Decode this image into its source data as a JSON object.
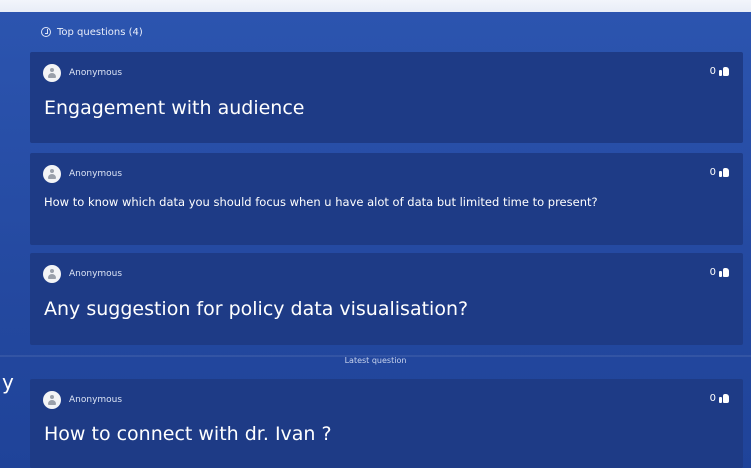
{
  "section": {
    "icon": "question-circle-icon",
    "title": "Top questions (4)"
  },
  "questions": [
    {
      "author": "Anonymous",
      "votes": "0",
      "text": "Engagement with audience"
    },
    {
      "author": "Anonymous",
      "votes": "0",
      "text": "How to know which data you should focus when u have alot of data but limited time to present?"
    },
    {
      "author": "Anonymous",
      "votes": "0",
      "text": "Any suggestion for policy data visualisation?"
    }
  ],
  "latest": {
    "label": "Latest question",
    "author": "Anonymous",
    "votes": "0",
    "text": "How to connect with dr. Ivan ?"
  },
  "side_mark": "y",
  "colors": {
    "background": "#2a52ad",
    "card": "#1e3b86",
    "text": "#ffffff"
  }
}
